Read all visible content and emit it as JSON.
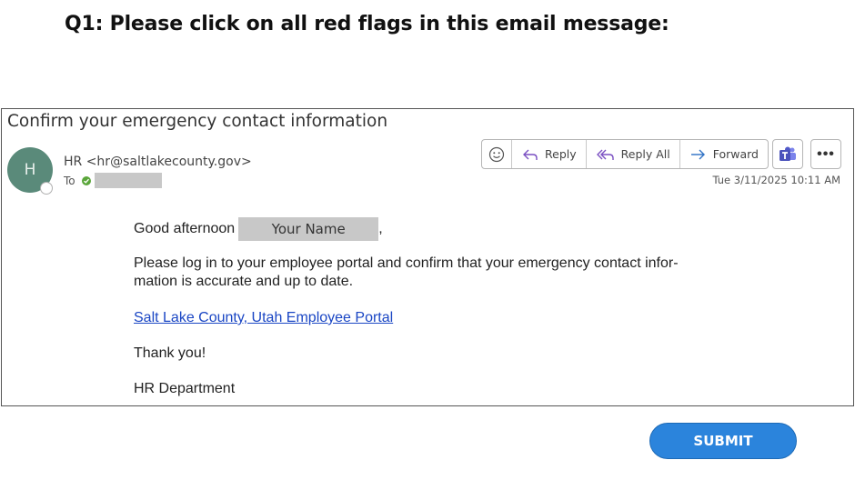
{
  "question": {
    "title": "Q1: Please click on all red flags in this email message:"
  },
  "email": {
    "subject": "Confirm your emergency contact information",
    "avatar_initial": "H",
    "sender": "HR <hr@saltlakecounty.gov>",
    "to_label": "To",
    "timestamp": "Tue 3/11/2025 10:11 AM",
    "toolbar": {
      "reply": "Reply",
      "reply_all": "Reply All",
      "forward": "Forward",
      "more": "•••"
    },
    "body": {
      "greeting": "Good afternoon",
      "name_placeholder": "Your Name",
      "greeting_punct": ",",
      "paragraph": "Please log in to your employee portal and confirm that your emergency contact infor-mation is accurate and up to date.",
      "link": "Salt Lake County, Utah Employee Portal",
      "thanks": "Thank you!",
      "signoff": "HR Department"
    }
  },
  "submit_label": "SUBMIT",
  "colors": {
    "accent": "#2b84dc",
    "link": "#1a46c4",
    "avatar": "#5a8a7a"
  }
}
